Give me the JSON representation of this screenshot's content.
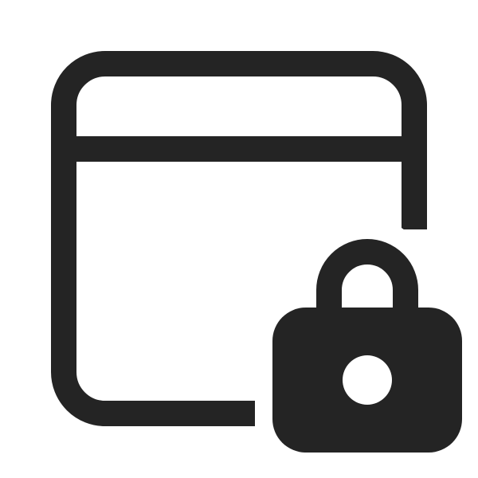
{
  "icon": {
    "name": "window-lock-icon",
    "parts": [
      "window-icon",
      "lock-icon"
    ]
  },
  "colors": {
    "background": "#ffffff",
    "stroke": "#242424",
    "fill": "#242424",
    "lock_keyhole": "#ffffff"
  }
}
